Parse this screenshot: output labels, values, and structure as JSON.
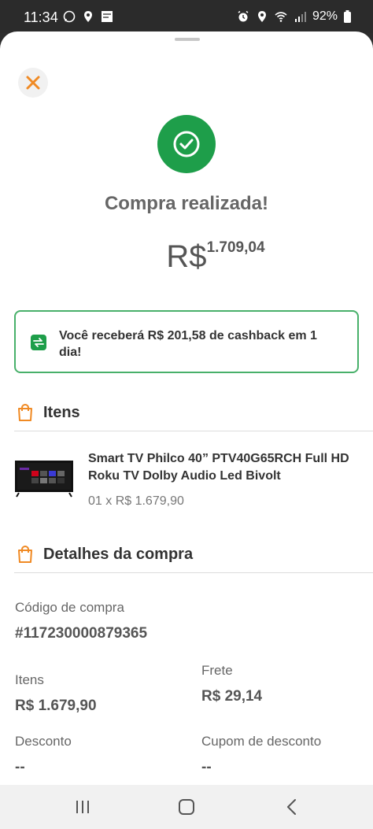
{
  "status_bar": {
    "time": "11:34",
    "battery": "92%",
    "left_icons": [
      "whatsapp-icon",
      "location-icon",
      "app-icon"
    ],
    "right_icons": [
      "alarm-icon",
      "location-icon",
      "wifi-icon",
      "signal-icon",
      "battery-icon"
    ]
  },
  "modal": {
    "close_icon": "close-icon",
    "success_icon": "check-icon",
    "title": "Compra realizada!",
    "amount_currency": "R$",
    "amount_value": "1.709,04",
    "cashback_text": "Você receberá R$ 201,58 de cashback em 1 dia!"
  },
  "items_section": {
    "title": "Itens",
    "product_name": "Smart TV Philco 40” PTV40G65RCH Full HD Roku TV Dolby Audio Led Bivolt",
    "product_qty": "01 x R$ 1.679,90"
  },
  "details_section": {
    "title": "Detalhes da compra",
    "purchase_code_label": "Código de compra",
    "purchase_code_value": "#117230000879365",
    "items_label": "Itens",
    "items_value": "R$ 1.679,90",
    "shipping_label": "Frete",
    "shipping_value": "R$ 29,14",
    "discount_label": "Desconto",
    "discount_value": "--",
    "coupon_label": "Cupom de desconto",
    "coupon_value": "--"
  },
  "colors": {
    "accent_orange": "#f08a24",
    "success_green": "#1e9e4a",
    "cashback_border": "#48b06a"
  }
}
